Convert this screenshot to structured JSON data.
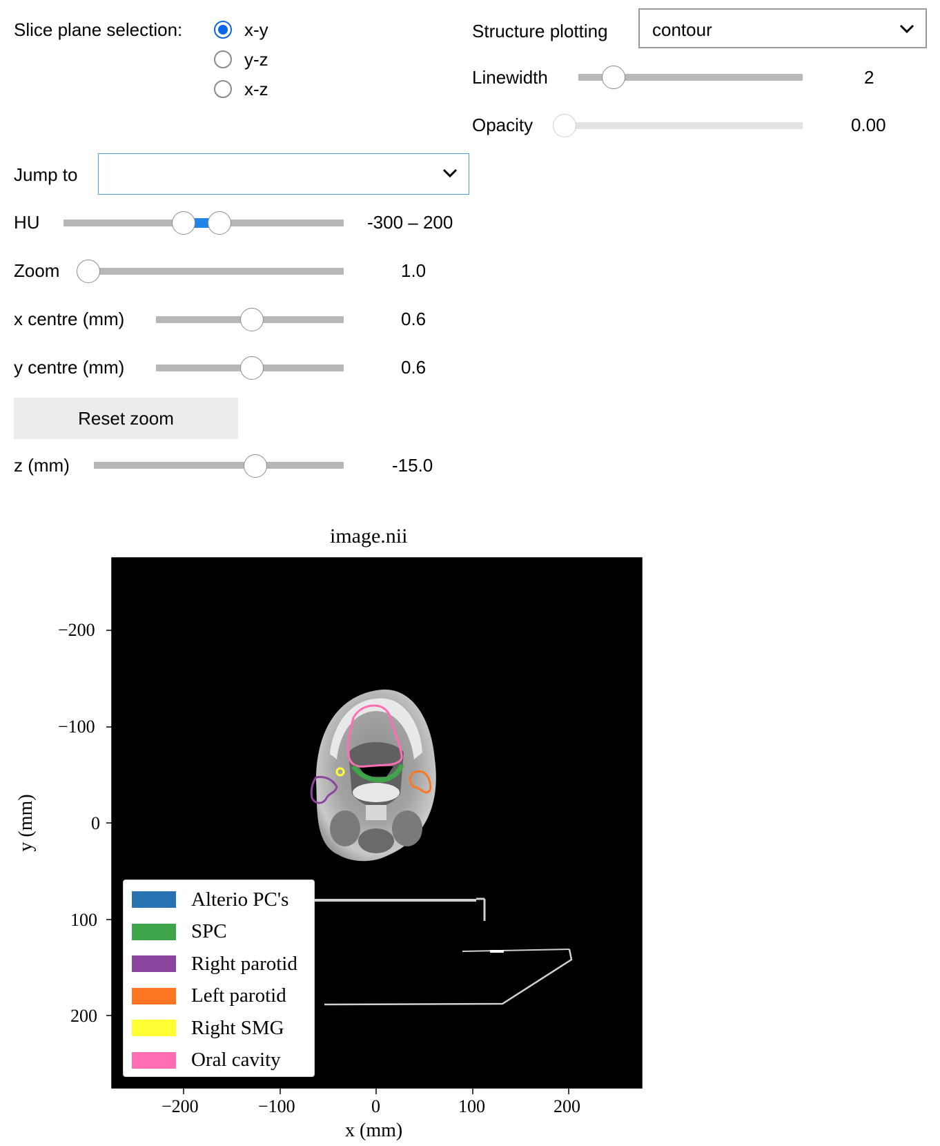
{
  "controls": {
    "slice_plane": {
      "label": "Slice plane selection:",
      "options": [
        "x-y",
        "y-z",
        "x-z"
      ],
      "selected": "x-y"
    },
    "structure_plotting": {
      "label": "Structure plotting",
      "value": "contour"
    },
    "linewidth": {
      "label": "Linewidth",
      "value": "2"
    },
    "opacity": {
      "label": "Opacity",
      "value": "0.00"
    },
    "jump_to": {
      "label": "Jump to",
      "value": ""
    },
    "hu": {
      "label": "HU",
      "value": "-300 – 200"
    },
    "zoom": {
      "label": "Zoom",
      "value": "1.0"
    },
    "x_centre": {
      "label": "x centre (mm)",
      "value": "0.6"
    },
    "y_centre": {
      "label": "y centre (mm)",
      "value": "0.6"
    },
    "reset_zoom": {
      "label": "Reset zoom"
    },
    "z": {
      "label": "z (mm)",
      "value": "-15.0"
    }
  },
  "plot": {
    "title": "image.nii",
    "xlabel": "x (mm)",
    "ylabel": "y (mm)",
    "x_ticks": [
      "−200",
      "−100",
      "0",
      "100",
      "200"
    ],
    "y_ticks": [
      "−200",
      "−100",
      "0",
      "100",
      "200"
    ],
    "legend": [
      {
        "name": "Alterio PC's",
        "color": "#2a73b2"
      },
      {
        "name": "SPC",
        "color": "#3ea54a"
      },
      {
        "name": "Right parotid",
        "color": "#8c46a0"
      },
      {
        "name": "Left parotid",
        "color": "#ff7622"
      },
      {
        "name": "Right SMG",
        "color": "#ffff33"
      },
      {
        "name": "Oral cavity",
        "color": "#ff6eb4"
      }
    ]
  }
}
